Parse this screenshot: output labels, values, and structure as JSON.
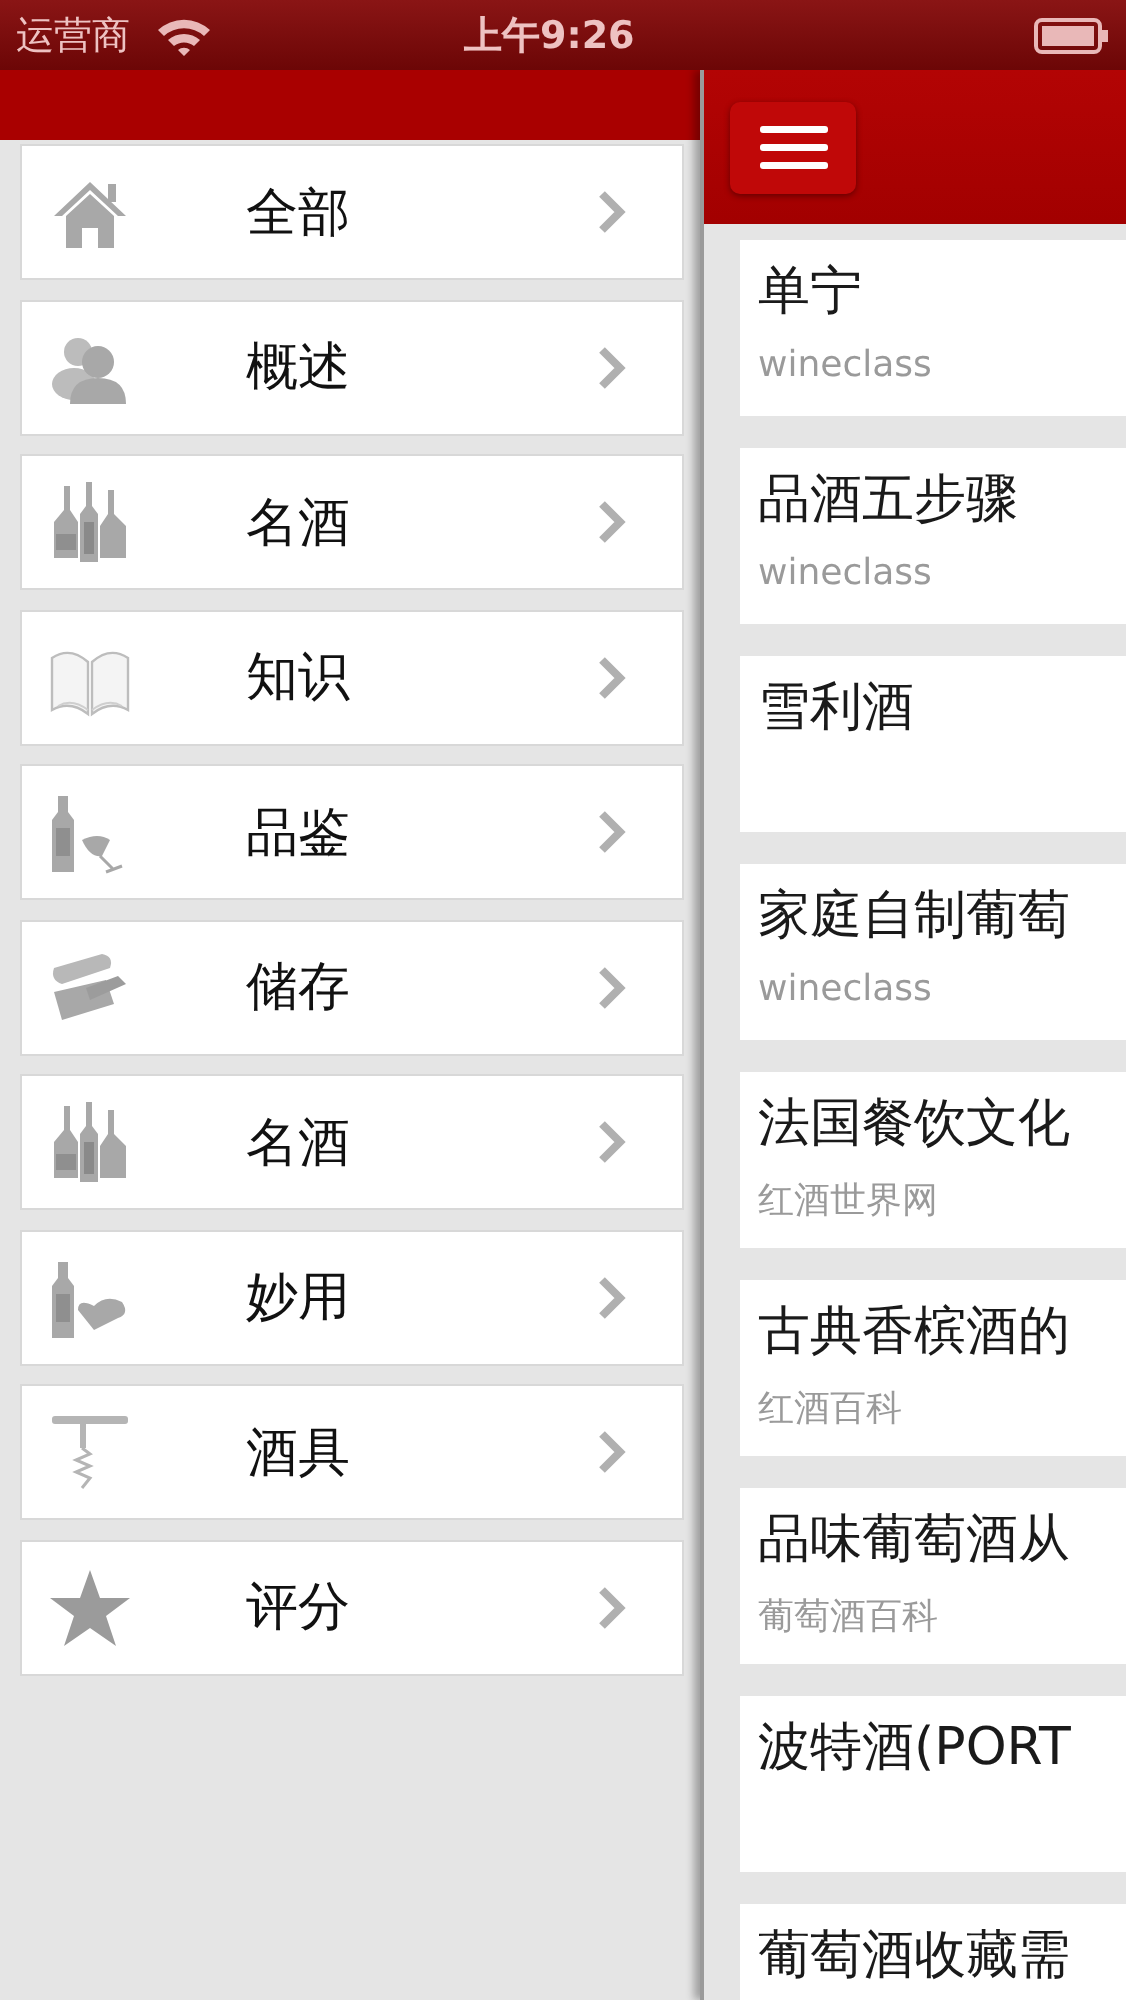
{
  "status_bar": {
    "carrier": "运营商",
    "time": "上午9:26"
  },
  "sidebar": {
    "items": [
      {
        "label": "全部"
      },
      {
        "label": "概述"
      },
      {
        "label": "名酒"
      },
      {
        "label": "知识"
      },
      {
        "label": "品鉴"
      },
      {
        "label": "储存"
      },
      {
        "label": "名酒"
      },
      {
        "label": "妙用"
      },
      {
        "label": "酒具"
      },
      {
        "label": "评分"
      }
    ]
  },
  "articles": [
    {
      "title": "单宁",
      "source": "wineclass"
    },
    {
      "title": "品酒五步骤",
      "source": "wineclass"
    },
    {
      "title": "雪利酒"
    },
    {
      "title": "家庭自制葡萄",
      "source": "wineclass"
    },
    {
      "title": "法国餐饮文化",
      "source": "红酒世界网"
    },
    {
      "title": "古典香槟酒的",
      "source": "红酒百科"
    },
    {
      "title": "品味葡萄酒从",
      "source": "葡萄酒百科"
    },
    {
      "title": "波特酒(PORT"
    },
    {
      "title": "葡萄酒收藏需"
    }
  ]
}
